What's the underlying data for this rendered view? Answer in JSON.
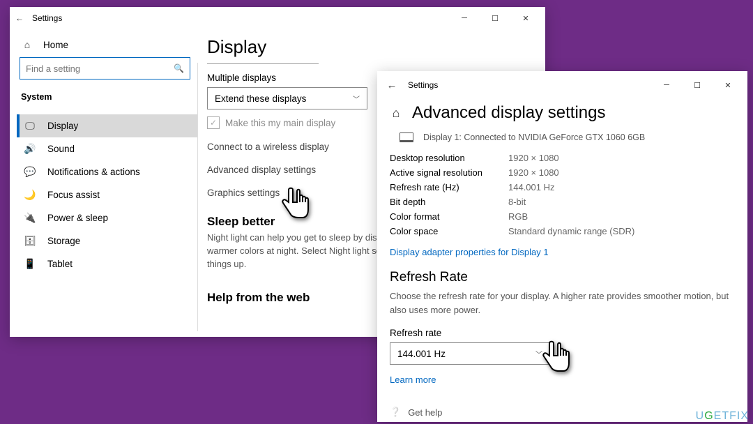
{
  "win1": {
    "title": "Settings",
    "home": "Home",
    "search_placeholder": "Find a setting",
    "section": "System",
    "sidebar": [
      {
        "icon": "🖵",
        "label": "Display",
        "selected": true
      },
      {
        "icon": "🔊",
        "label": "Sound"
      },
      {
        "icon": "💬",
        "label": "Notifications & actions"
      },
      {
        "icon": "🌙",
        "label": "Focus assist"
      },
      {
        "icon": "🔌",
        "label": "Power & sleep"
      },
      {
        "icon": "🗄",
        "label": "Storage"
      },
      {
        "icon": "📱",
        "label": "Tablet"
      }
    ],
    "page_title": "Display",
    "multiple_displays_label": "Multiple displays",
    "multiple_displays_value": "Extend these displays",
    "make_main": "Make this my main display",
    "connect_wireless": "Connect to a wireless display",
    "advanced_link": "Advanced display settings",
    "graphics_link": "Graphics settings",
    "sleep_title": "Sleep better",
    "sleep_para": "Night light can help you get to sleep by displaying warmer colors at night. Select Night light settings to set things up.",
    "help_title": "Help from the web"
  },
  "win2": {
    "title_small": "Settings",
    "heading": "Advanced display settings",
    "connected": "Display 1: Connected to NVIDIA GeForce GTX 1060 6GB",
    "rows": [
      {
        "k": "Desktop resolution",
        "v": "1920 × 1080"
      },
      {
        "k": "Active signal resolution",
        "v": "1920 × 1080"
      },
      {
        "k": "Refresh rate (Hz)",
        "v": "144.001 Hz"
      },
      {
        "k": "Bit depth",
        "v": "8-bit"
      },
      {
        "k": "Color format",
        "v": "RGB"
      },
      {
        "k": "Color space",
        "v": "Standard dynamic range (SDR)"
      }
    ],
    "adapter_link": "Display adapter properties for Display 1",
    "refresh_title": "Refresh Rate",
    "refresh_para": "Choose the refresh rate for your display. A higher rate provides smoother motion, but also uses more power.",
    "rr_label": "Refresh rate",
    "rr_value": "144.001 Hz",
    "learn_more": "Learn more",
    "get_help": "Get help"
  },
  "watermark": "UGETFIX"
}
